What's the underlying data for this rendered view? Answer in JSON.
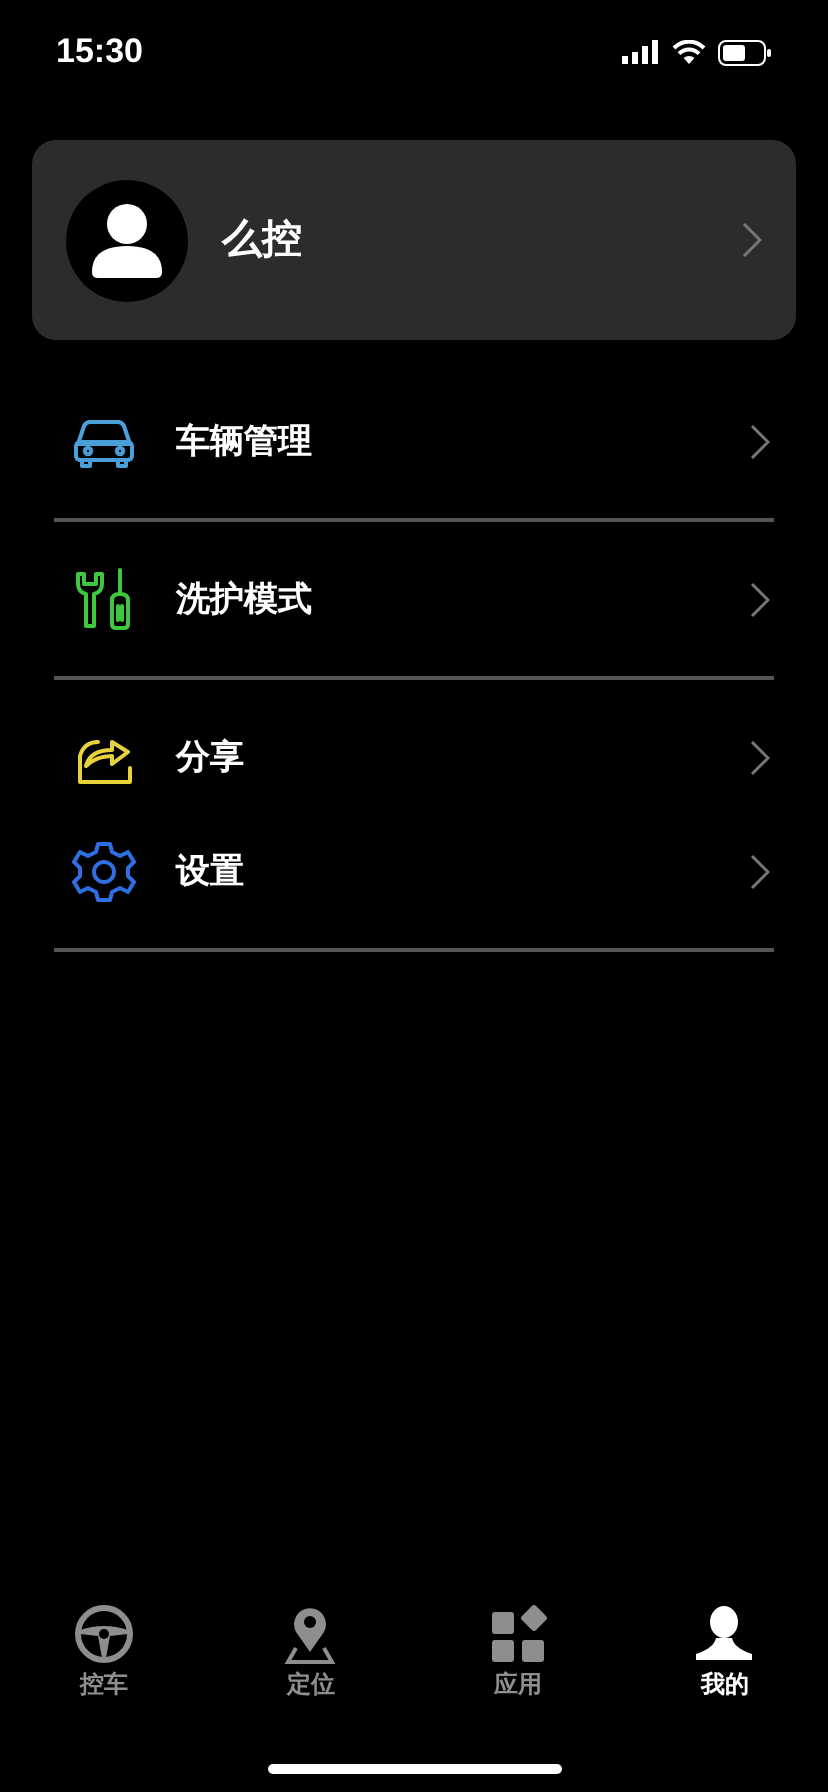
{
  "status_bar": {
    "time": "15:30"
  },
  "profile": {
    "name": "么控"
  },
  "menu_groups": [
    {
      "items": [
        {
          "kind": "car",
          "label": "车辆管理",
          "color": "#4a9fd8"
        }
      ]
    },
    {
      "items": [
        {
          "kind": "tools",
          "label": "洗护模式",
          "color": "#3fc73f"
        }
      ]
    },
    {
      "items": [
        {
          "kind": "share",
          "label": "分享",
          "color": "#e6d23a"
        },
        {
          "kind": "gear",
          "label": "设置",
          "color": "#2f6fe0"
        }
      ]
    }
  ],
  "tab_bar": [
    {
      "kind": "wheel",
      "label": "控车",
      "selected": false
    },
    {
      "kind": "pin",
      "label": "定位",
      "selected": false
    },
    {
      "kind": "apps",
      "label": "应用",
      "selected": false
    },
    {
      "kind": "person",
      "label": "我的",
      "selected": true
    }
  ]
}
